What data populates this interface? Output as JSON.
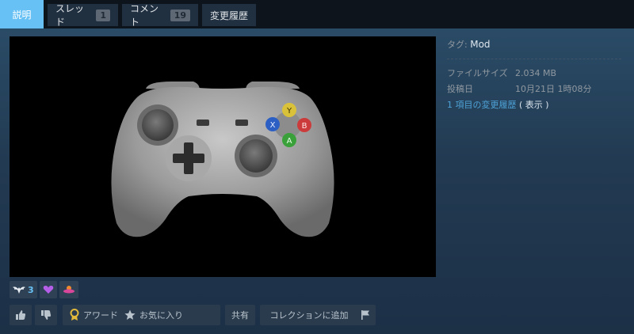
{
  "tabs": [
    {
      "label": "説明",
      "count": null,
      "active": true
    },
    {
      "label": "スレッド",
      "count": "1",
      "active": false
    },
    {
      "label": "コメント",
      "count": "19",
      "active": false
    },
    {
      "label": "変更履歴",
      "count": null,
      "active": false
    }
  ],
  "preview": {
    "buttons": {
      "y": "Y",
      "x": "X",
      "b": "B",
      "a": "A"
    }
  },
  "details": {
    "tag_label": "タグ:",
    "tag_value": "Mod",
    "file_size_label": "ファイルサイズ",
    "file_size_value": "2.034 MB",
    "posted_label": "投稿日",
    "posted_value": "10月21日 1時08分",
    "changes_link": "1 項目の変更履歴",
    "changes_show": "( 表示 )"
  },
  "awards": {
    "first_count": "3"
  },
  "actions": {
    "award_label": "アワード",
    "favorite_label": "お気に入り",
    "share_label": "共有",
    "collection_label": "コレクションに追加"
  },
  "colors": {
    "accent": "#67c1f5",
    "background": "#1b2838",
    "button_y": "#d9c23a",
    "button_x": "#2c5fc4",
    "button_b": "#cc3b3b",
    "button_a": "#3aa13a"
  }
}
